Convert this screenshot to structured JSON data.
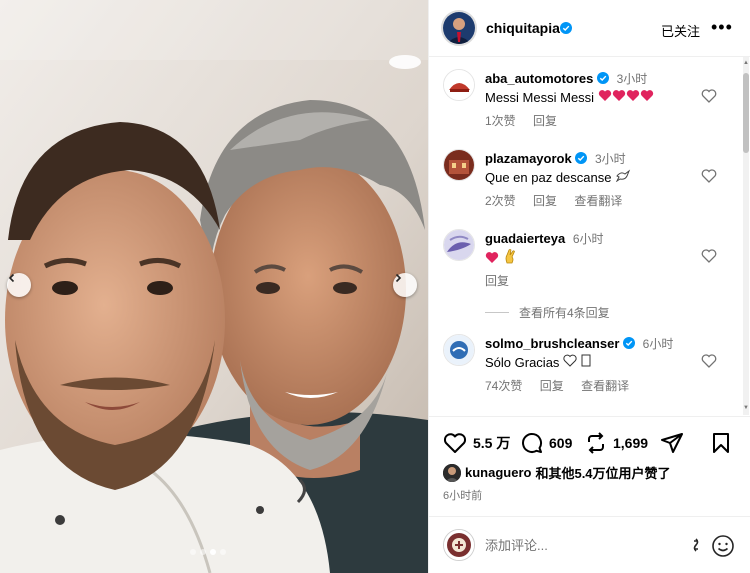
{
  "post": {
    "username": "chiquitapia",
    "follow_label": "已关注",
    "more_label": "•••",
    "carousel": {
      "slides": 4,
      "active_slide": 3
    }
  },
  "comments": [
    {
      "user": "aba_automotores",
      "verified": true,
      "time": "3小时",
      "text": "Messi Messi Messi ❤️❤️❤️❤️",
      "text_plain": "Messi Messi Messi",
      "likes": "1次赞",
      "reply": "回复",
      "translate": ""
    },
    {
      "user": "plazamayorok",
      "verified": true,
      "time": "3小时",
      "text_plain": "Que en paz descanse",
      "likes": "2次赞",
      "reply": "回复",
      "translate": "查看翻译"
    },
    {
      "user": "guadaierteya",
      "verified": false,
      "time": "6小时",
      "likes": "",
      "reply": "回复",
      "translate": ""
    },
    {
      "user": "solmo_brushcleanser",
      "verified": true,
      "time": "6小时",
      "text_plain": "Sólo Gracias",
      "likes": "74次赞",
      "reply": "回复",
      "translate": "查看翻译"
    }
  ],
  "view_replies": "查看所有4条回复",
  "actions": {
    "likes": "5.5 万",
    "comments": "609",
    "reposts": "1,699"
  },
  "liked_by": {
    "user": "kunaguero",
    "suffix": "和其他5.4万位用户赞了"
  },
  "post_time": "6小时前",
  "composer": {
    "placeholder": "添加评论..."
  },
  "colors": {
    "secondary_text": "#737373",
    "verified_blue": "#0095f6",
    "heart_red": "#e0245e"
  }
}
